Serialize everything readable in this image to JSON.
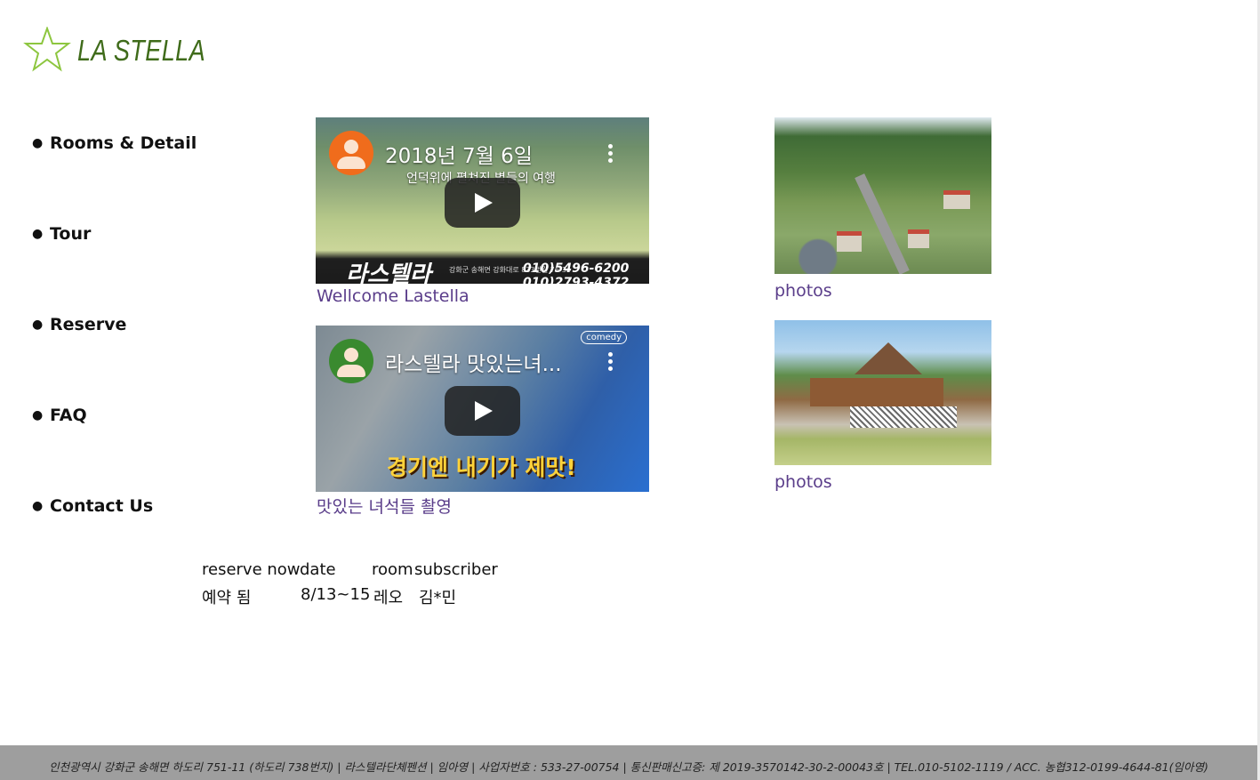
{
  "logo": {
    "text": "LA STELLA",
    "color": "#8dc63f"
  },
  "nav": {
    "items": [
      {
        "label": "Rooms & Detail"
      },
      {
        "label": "Tour"
      },
      {
        "label": "Reserve"
      },
      {
        "label": "FAQ"
      },
      {
        "label": "Contact Us"
      }
    ]
  },
  "videos": [
    {
      "title": "2018년 7월 6일",
      "subtitle": "언덕위에 펼쳐진 별들의 여행",
      "banner_title": "라스텔라",
      "banner_small": "강화군 송해면 강화대로 833번길 76-34",
      "banner_tel_1": "010)5496-6200",
      "banner_tel_2": "010)2793-4372",
      "link": "Wellcome Lastella"
    },
    {
      "title": "라스텔라 맛있는녀...",
      "caption": "경기엔 내기가 제맛!",
      "badge": "comedy",
      "link": "맛있는 녀석들 촬영"
    }
  ],
  "photos": [
    {
      "link": "photos"
    },
    {
      "link": "photos"
    }
  ],
  "reservation": {
    "headers": [
      "reserve now",
      "date",
      "room",
      "subscriber"
    ],
    "row": [
      "예약 됨",
      "8/13~15",
      "레오",
      "김*민"
    ]
  },
  "footer": {
    "text": "인천광역시 강화군 송해면 하도리 751-11 (하도리 738번지) | 라스텔라단체펜션 | 임아영 | 사업자번호 : 533-27-00754 | 통신판매신고증: 제 2019-3570142-30-2-00043호 | TEL.010-5102-1119 / ACC. 농협312-0199-4644-81(임아영)"
  },
  "colors": {
    "link": "#5a3d8a",
    "footer_bg": "#9e9e9e"
  }
}
